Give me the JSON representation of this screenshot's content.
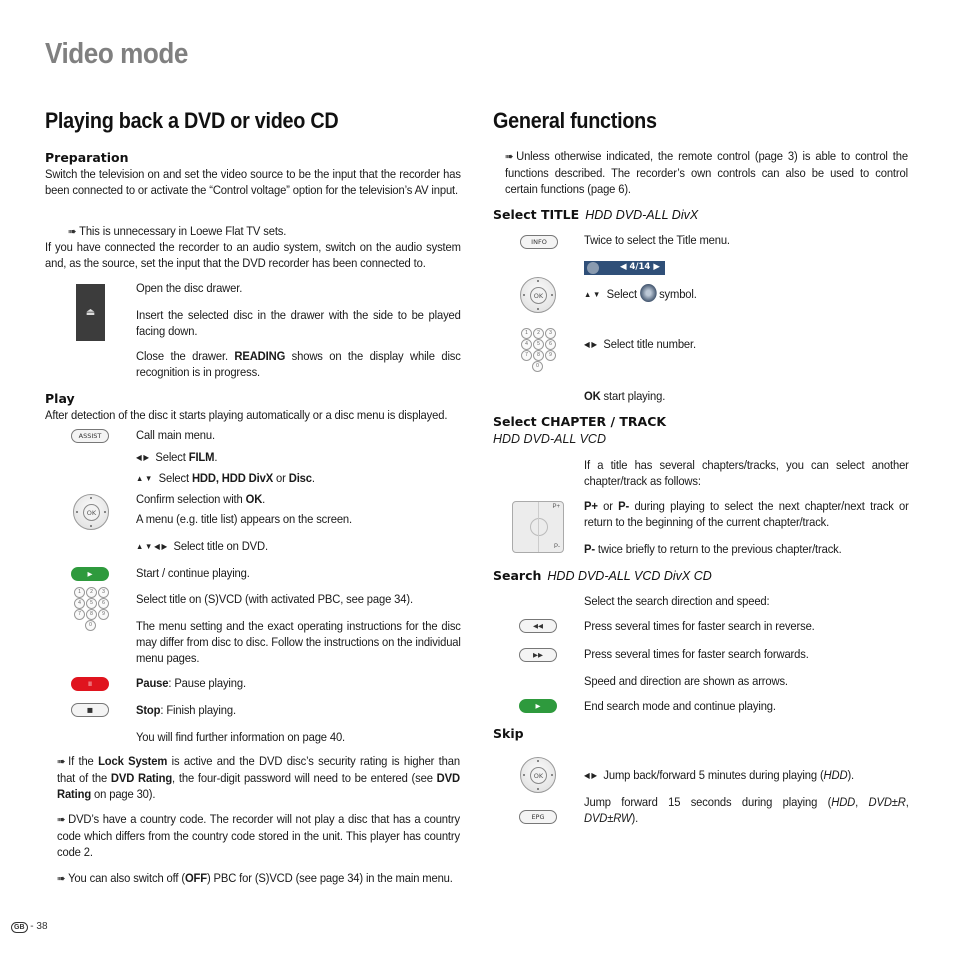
{
  "page_title": "Video mode",
  "left": {
    "heading": "Playing back a DVD or video CD",
    "preparation": {
      "heading": "Preparation",
      "p1": "Switch the television on and set the video source to be the input that the recorder has been connected to or activate the “Control voltage” option for the television’s AV input.",
      "note": "This is unnecessary in Loewe Flat TV sets.",
      "p2": "If you have connected the recorder to an audio system, switch on the audio system and, as the source, set the input that the DVD recorder has been connected to.",
      "eject_icon": "⏏",
      "eject_step1": "Open the disc drawer.",
      "eject_step2": "Insert the selected disc in the drawer with the side to be played facing down.",
      "eject_step3_a": "Close the drawer.",
      "eject_step3_b": "READING",
      "eject_step3_c": "shows on the display while disc recognition is in progress."
    },
    "play": {
      "heading": "Play",
      "intro": "After detection of the disc it starts playing automatically or a disc menu is displayed.",
      "assist_label": "ASSIST",
      "call_menu": "Call main menu.",
      "select_film_a": "Select",
      "select_film_b": "FILM",
      "select_src_a": "Select",
      "select_src_b": "HDD, HDD DivX",
      "select_src_c": "or",
      "select_src_d": "Disc",
      "confirm_a": "Confirm selection with",
      "confirm_b": "OK",
      "menu_appears": "A menu (e.g. title list) appears on the screen.",
      "select_title_dvd": "Select title on DVD.",
      "play_icon": "▶",
      "start_continue": "Start / continue playing.",
      "select_svcd": "Select title on (S)VCD (with activated PBC, see page 34).",
      "menu_setting": "The menu setting and the exact operating instructions for the disc may differ from disc to disc. Follow the instructions on the individual menu pages.",
      "pause_icon": "II",
      "pause_a": "Pause",
      "pause_b": ": Pause playing.",
      "stop_icon": "■",
      "stop_a": "Stop",
      "stop_b": ": Finish playing.",
      "further_info": "You will find further information on page 40."
    },
    "notes": {
      "n1_a": "If the",
      "n1_b": "Lock System",
      "n1_c": "is active and the DVD disc’s security rating is higher than that of the",
      "n1_d": "DVD Rating",
      "n1_e": ", the four-digit password will need to be entered (see",
      "n1_f": "DVD Rating",
      "n1_g": "on page 30).",
      "n2": "DVD’s have a country code. The recorder will not play a disc that has a country code which differs from the country code stored in the unit. This player has country code 2.",
      "n3_a": "You can also switch off (",
      "n3_b": "OFF",
      "n3_c": ") PBC for (S)VCD (see page 34) in the main menu."
    }
  },
  "right": {
    "heading": "General functions",
    "intro": "Unless otherwise indicated, the remote control (page 3) is able to control the functions described. The recorder’s own controls can also be used to control certain functions (page 6).",
    "select_title": {
      "heading": "Select TITLE",
      "modes": "HDD  DVD-ALL  DivX",
      "info_label": "INFO",
      "twice": "Twice to select the Title menu.",
      "titlebar_value": "4/14",
      "select_symbol_a": "Select",
      "select_symbol_b": "symbol.",
      "select_number": "Select title number.",
      "ok_a": "OK",
      "ok_b": "start playing."
    },
    "select_chapter": {
      "heading": "Select CHAPTER / TRACK",
      "modes": "HDD  DVD-ALL  VCD",
      "intro": "If a title has several chapters/tracks, you can select another chapter/track as follows:",
      "p_a": "P+",
      "p_b": "or",
      "p_c": "P-",
      "p_d": "during playing to select the next chapter/next track or return to the beginning of the current chapter/track.",
      "twice_a": "P-",
      "twice_b": "twice briefly to return to the previous chapter/track."
    },
    "search": {
      "heading": "Search",
      "modes": "HDD  DVD-ALL  VCD DivX  CD",
      "select_dir": "Select the search direction and speed:",
      "rew_icon": "◀◀",
      "rew": "Press several times for faster search in reverse.",
      "ff_icon": "▶▶",
      "ff": "Press several times for faster search forwards.",
      "arrows": "Speed and direction are shown as arrows.",
      "play_icon": "▶",
      "end": "End search mode and continue playing."
    },
    "skip": {
      "heading": "Skip",
      "jump5_a": "Jump back/forward 5 minutes during playing (",
      "jump5_b": "HDD",
      "jump5_c": ").",
      "epg_label": "EPG",
      "jump15_a": "Jump forward 15 seconds during playing (",
      "jump15_b": "HDD",
      "jump15_c": ", ",
      "jump15_d": "DVD±R",
      "jump15_e": ", ",
      "jump15_f": "DVD±RW",
      "jump15_g": ")."
    }
  },
  "footer": {
    "country_badge": "GB",
    "page_number": "- 38"
  }
}
